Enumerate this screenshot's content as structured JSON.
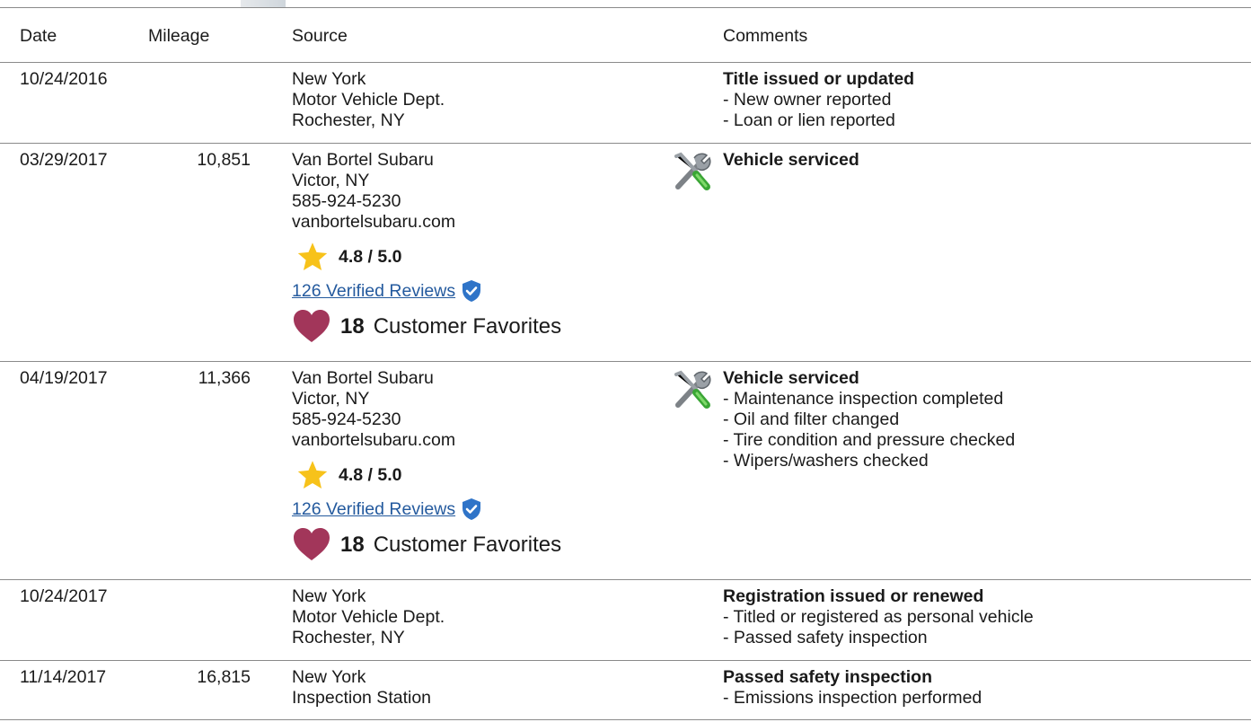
{
  "columns": {
    "date": "Date",
    "mileage": "Mileage",
    "source": "Source",
    "comments": "Comments"
  },
  "rows": [
    {
      "date": "10/24/2016",
      "mileage": "",
      "source": [
        "New York",
        "Motor Vehicle Dept.",
        "Rochester, NY"
      ],
      "comment_title": "Title issued or updated",
      "comment_items": [
        "- New owner reported",
        "- Loan or lien reported"
      ]
    },
    {
      "date": "03/29/2017",
      "mileage": "10,851",
      "source": [
        "Van Bortel Subaru",
        "Victor, NY",
        "585-924-5230",
        "vanbortelsubaru.com"
      ],
      "rating": "4.8 / 5.0",
      "reviews": "126 Verified Reviews",
      "favorites_count": "18",
      "favorites_label": "Customer Favorites",
      "comment_icon": "service-tools-icon",
      "comment_title": "Vehicle serviced",
      "comment_items": []
    },
    {
      "date": "04/19/2017",
      "mileage": "11,366",
      "source": [
        "Van Bortel Subaru",
        "Victor, NY",
        "585-924-5230",
        "vanbortelsubaru.com"
      ],
      "rating": "4.8 / 5.0",
      "reviews": "126 Verified Reviews",
      "favorites_count": "18",
      "favorites_label": "Customer Favorites",
      "comment_icon": "service-tools-icon",
      "comment_title": "Vehicle serviced",
      "comment_items": [
        "- Maintenance inspection completed",
        "- Oil and filter changed",
        "- Tire condition and pressure checked",
        "- Wipers/washers checked"
      ]
    },
    {
      "date": "10/24/2017",
      "mileage": "",
      "source": [
        "New York",
        "Motor Vehicle Dept.",
        "Rochester, NY"
      ],
      "comment_title": "Registration issued or renewed",
      "comment_items": [
        "- Titled or registered as personal vehicle",
        "- Passed safety inspection"
      ]
    },
    {
      "date": "11/14/2017",
      "mileage": "16,815",
      "source": [
        "New York",
        "Inspection Station"
      ],
      "comment_title": "Passed safety inspection",
      "comment_items": [
        "- Emissions inspection performed"
      ]
    }
  ],
  "colors": {
    "link": "#245a9e",
    "star": "#f7c21a",
    "heart": "#a2365a",
    "shield": "#2f74c8",
    "border": "#8a8a8a"
  }
}
